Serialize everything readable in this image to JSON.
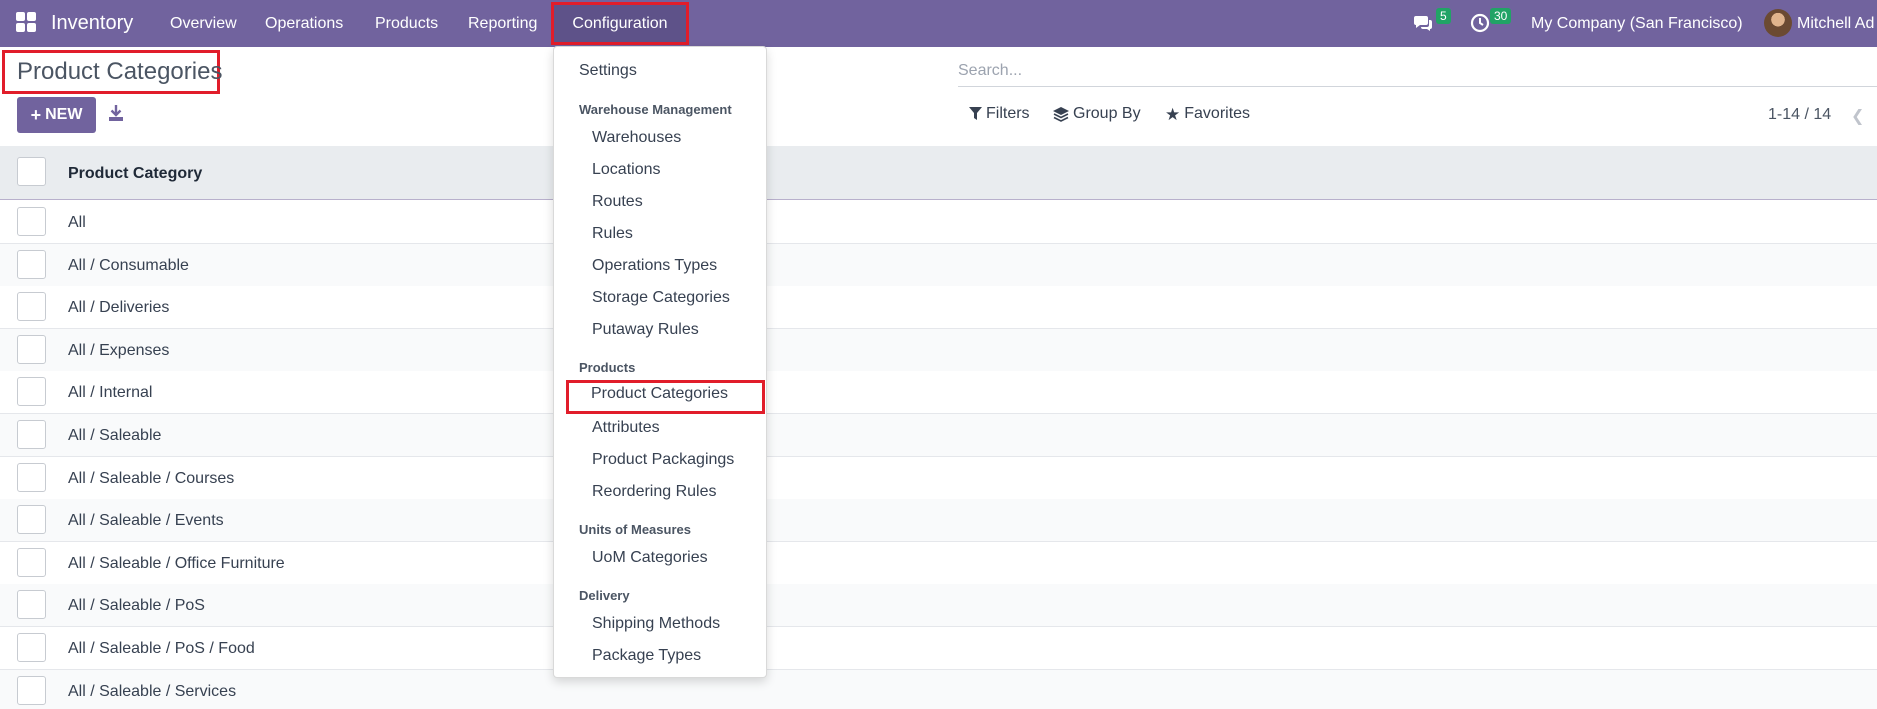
{
  "navbar": {
    "brand": "Inventory",
    "menu": [
      "Overview",
      "Operations",
      "Products",
      "Reporting"
    ],
    "config_label": "Configuration",
    "messages_count": "5",
    "activities_count": "30",
    "company": "My Company (San Francisco)",
    "user": "Mitchell Ad"
  },
  "control": {
    "title": "Product Categories",
    "new_label": "NEW",
    "search_placeholder": "Search...",
    "filters_label": "Filters",
    "groupby_label": "Group By",
    "favorites_label": "Favorites",
    "pager": "1-14 / 14"
  },
  "list": {
    "column": "Product Category",
    "rows": [
      "All",
      "All / Consumable",
      "All / Deliveries",
      "All / Expenses",
      "All / Internal",
      "All / Saleable",
      "All / Saleable / Courses",
      "All / Saleable / Events",
      "All / Saleable / Office Furniture",
      "All / Saleable / PoS",
      "All / Saleable / PoS / Food",
      "All / Saleable / Services"
    ]
  },
  "dropdown": {
    "settings": "Settings",
    "warehouse_header": "Warehouse Management",
    "warehouse_items": [
      "Warehouses",
      "Locations",
      "Routes",
      "Rules",
      "Operations Types",
      "Storage Categories",
      "Putaway Rules"
    ],
    "products_header": "Products",
    "products_items": [
      "Product Categories",
      "Attributes",
      "Product Packagings",
      "Reordering Rules"
    ],
    "uom_header": "Units of Measures",
    "uom_items": [
      "UoM Categories"
    ],
    "delivery_header": "Delivery",
    "delivery_items": [
      "Shipping Methods",
      "Package Types"
    ]
  },
  "colors": {
    "navbar": "#71639e",
    "highlight": "#e11d2a",
    "badge": "#21a366"
  }
}
